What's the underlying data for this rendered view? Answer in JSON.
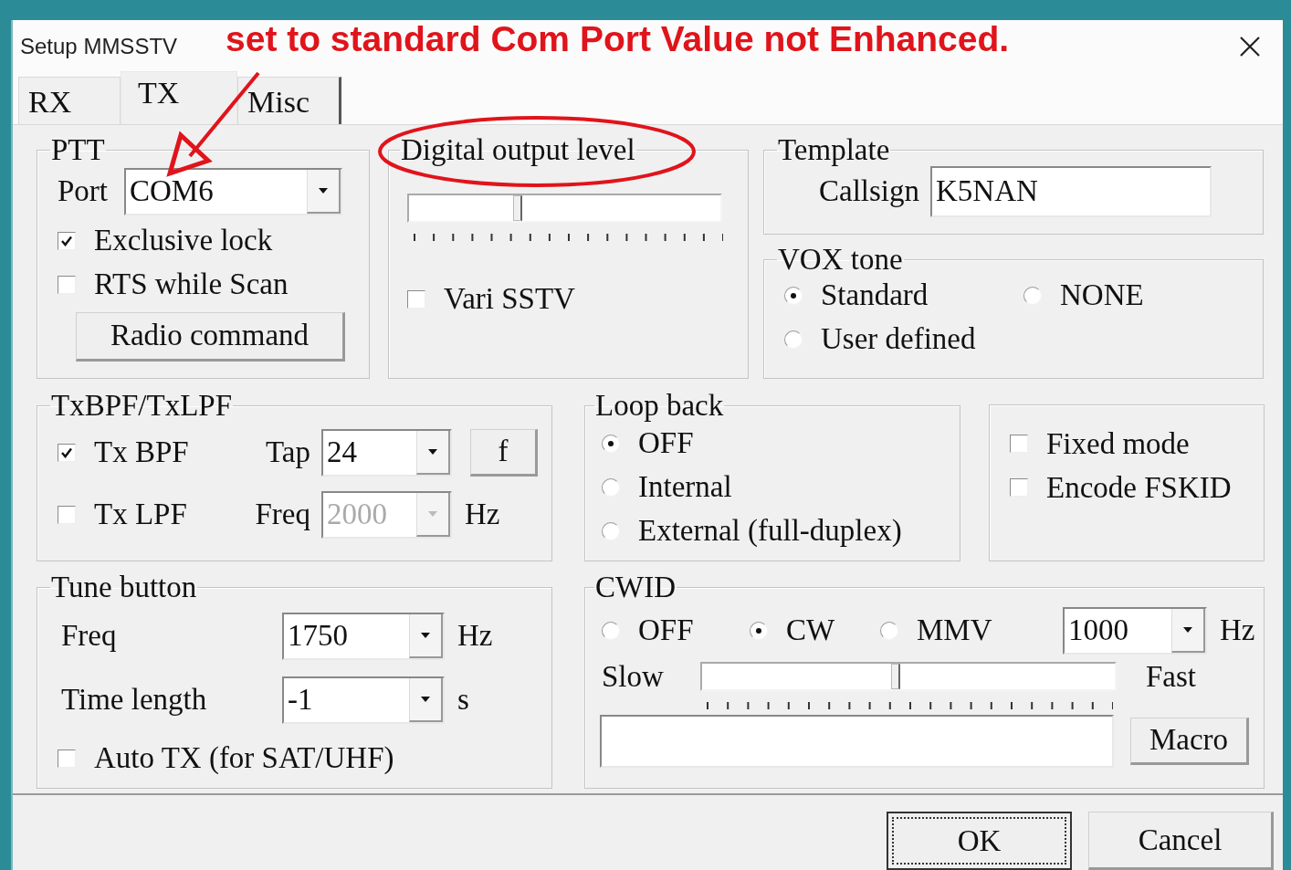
{
  "window": {
    "title": "Setup MMSSTV"
  },
  "annotation": {
    "text": "set to standard Com Port Value not Enhanced."
  },
  "tabs": [
    {
      "label": "RX",
      "selected": false
    },
    {
      "label": "TX",
      "selected": true
    },
    {
      "label": "Misc",
      "selected": false
    }
  ],
  "ptt": {
    "title": "PTT",
    "port_label": "Port",
    "port": "COM6",
    "checkboxes": [
      {
        "label": "Exclusive lock",
        "checked": true
      },
      {
        "label": "RTS while Scan",
        "checked": false
      }
    ],
    "button": "Radio command"
  },
  "digital_output": {
    "title": "Digital output level",
    "level": 0.35,
    "checkbox": {
      "label": "Vari SSTV",
      "checked": false
    }
  },
  "template": {
    "title": "Template",
    "callsign_label": "Callsign",
    "callsign": "K5NAN"
  },
  "vox_tone": {
    "title": "VOX tone",
    "options": [
      {
        "label": "Standard",
        "selected": true
      },
      {
        "label": "NONE",
        "selected": false
      },
      {
        "label": "User defined",
        "selected": false
      }
    ]
  },
  "filters": {
    "title": "TxBPF/TxLPF",
    "rows": [
      {
        "label": "Tx BPF",
        "checked": true,
        "field_label": "Tap",
        "value": "24",
        "disabled": false,
        "button": "f"
      },
      {
        "label": "Tx LPF",
        "checked": false,
        "field_label": "Freq",
        "value": "2000",
        "disabled": true,
        "unit": "Hz"
      }
    ]
  },
  "tune_button": {
    "title": "Tune button",
    "rows": [
      {
        "label": "Freq",
        "value": "1750",
        "unit": "Hz"
      },
      {
        "label": "Time length",
        "value": "-1",
        "unit": "s"
      }
    ],
    "checkbox": {
      "label": "Auto TX (for SAT/UHF)",
      "checked": false
    }
  },
  "loop_back": {
    "title": "Loop back",
    "options": [
      {
        "label": "OFF",
        "selected": true
      },
      {
        "label": "Internal",
        "selected": false
      },
      {
        "label": "External (full-duplex)",
        "selected": false
      }
    ]
  },
  "modes": {
    "checkboxes": [
      {
        "label": "Fixed mode",
        "checked": false
      },
      {
        "label": "Encode FSKID",
        "checked": false
      }
    ]
  },
  "cwid": {
    "title": "CWID",
    "options": [
      {
        "label": "OFF",
        "selected": false
      },
      {
        "label": "CW",
        "selected": true
      },
      {
        "label": "MMV",
        "selected": false
      }
    ],
    "freq": "1000",
    "unit": "Hz",
    "slow_label": "Slow",
    "fast_label": "Fast",
    "level": 0.47,
    "macro_button": "Macro"
  },
  "buttons": [
    {
      "label": "OK",
      "focused": true
    },
    {
      "label": "Cancel",
      "focused": false
    }
  ]
}
